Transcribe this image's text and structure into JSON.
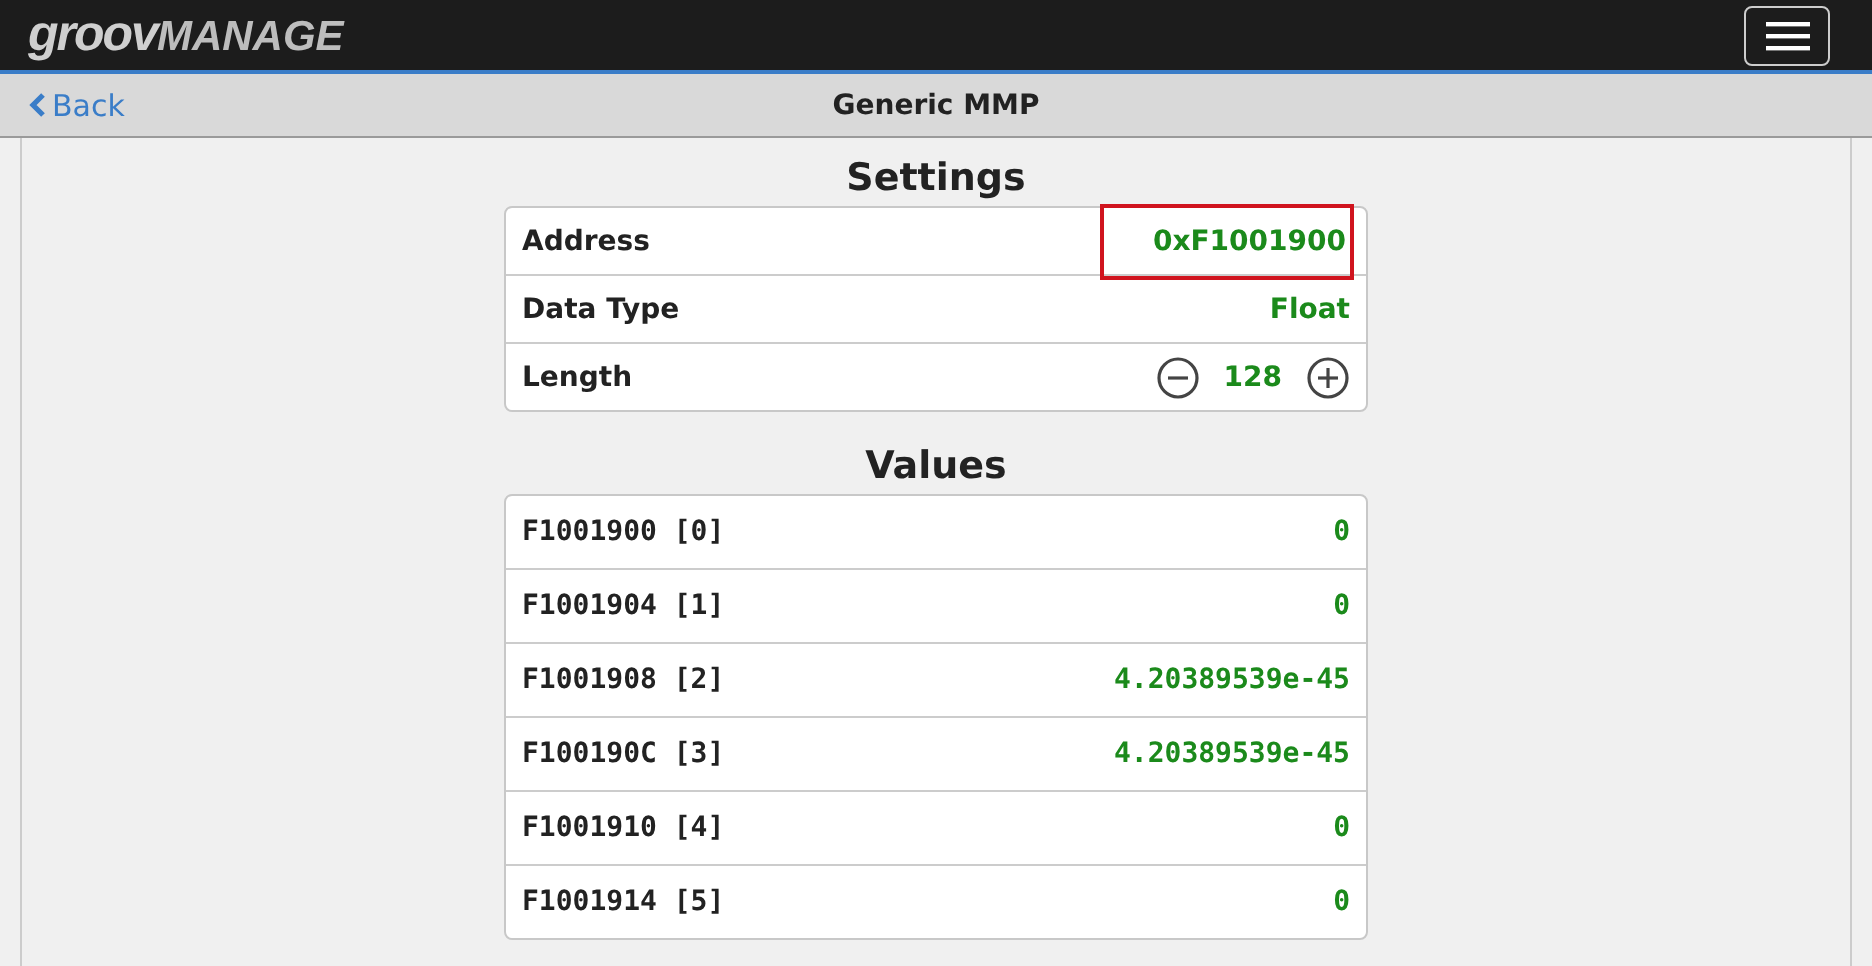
{
  "header": {
    "logo": {
      "brand": "groov",
      "product": "MANAGE"
    }
  },
  "nav": {
    "back": "Back",
    "title": "Generic MMP"
  },
  "settings": {
    "title": "Settings",
    "rows": [
      {
        "kind": "text",
        "label": "Address",
        "value": "0xF1001900",
        "highlighted": true
      },
      {
        "kind": "text",
        "label": "Data Type",
        "value": "Float",
        "highlighted": false
      },
      {
        "kind": "stepper",
        "label": "Length",
        "value": "128",
        "highlighted": false
      }
    ]
  },
  "values": {
    "title": "Values",
    "rows": [
      {
        "label": "F1001900 [0]",
        "value": "0"
      },
      {
        "label": "F1001904 [1]",
        "value": "0"
      },
      {
        "label": "F1001908 [2]",
        "value": "4.20389539e-45"
      },
      {
        "label": "F100190C [3]",
        "value": "4.20389539e-45"
      },
      {
        "label": "F1001910 [4]",
        "value": "0"
      },
      {
        "label": "F1001914 [5]",
        "value": "0"
      }
    ]
  }
}
